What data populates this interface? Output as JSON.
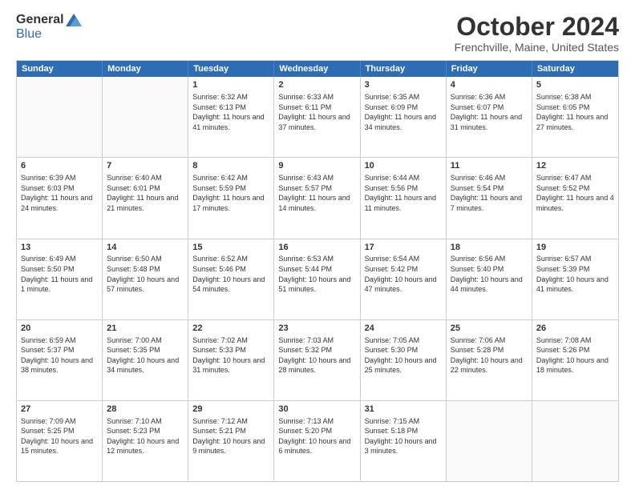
{
  "header": {
    "logo": {
      "general": "General",
      "blue": "Blue"
    },
    "title": "October 2024",
    "location": "Frenchville, Maine, United States"
  },
  "calendar": {
    "days": [
      "Sunday",
      "Monday",
      "Tuesday",
      "Wednesday",
      "Thursday",
      "Friday",
      "Saturday"
    ],
    "rows": [
      [
        {
          "day": "",
          "content": "",
          "empty": true
        },
        {
          "day": "",
          "content": "",
          "empty": true
        },
        {
          "day": "1",
          "content": "Sunrise: 6:32 AM\nSunset: 6:13 PM\nDaylight: 11 hours and 41 minutes.",
          "empty": false
        },
        {
          "day": "2",
          "content": "Sunrise: 6:33 AM\nSunset: 6:11 PM\nDaylight: 11 hours and 37 minutes.",
          "empty": false
        },
        {
          "day": "3",
          "content": "Sunrise: 6:35 AM\nSunset: 6:09 PM\nDaylight: 11 hours and 34 minutes.",
          "empty": false
        },
        {
          "day": "4",
          "content": "Sunrise: 6:36 AM\nSunset: 6:07 PM\nDaylight: 11 hours and 31 minutes.",
          "empty": false
        },
        {
          "day": "5",
          "content": "Sunrise: 6:38 AM\nSunset: 6:05 PM\nDaylight: 11 hours and 27 minutes.",
          "empty": false
        }
      ],
      [
        {
          "day": "6",
          "content": "Sunrise: 6:39 AM\nSunset: 6:03 PM\nDaylight: 11 hours and 24 minutes.",
          "empty": false
        },
        {
          "day": "7",
          "content": "Sunrise: 6:40 AM\nSunset: 6:01 PM\nDaylight: 11 hours and 21 minutes.",
          "empty": false
        },
        {
          "day": "8",
          "content": "Sunrise: 6:42 AM\nSunset: 5:59 PM\nDaylight: 11 hours and 17 minutes.",
          "empty": false
        },
        {
          "day": "9",
          "content": "Sunrise: 6:43 AM\nSunset: 5:57 PM\nDaylight: 11 hours and 14 minutes.",
          "empty": false
        },
        {
          "day": "10",
          "content": "Sunrise: 6:44 AM\nSunset: 5:56 PM\nDaylight: 11 hours and 11 minutes.",
          "empty": false
        },
        {
          "day": "11",
          "content": "Sunrise: 6:46 AM\nSunset: 5:54 PM\nDaylight: 11 hours and 7 minutes.",
          "empty": false
        },
        {
          "day": "12",
          "content": "Sunrise: 6:47 AM\nSunset: 5:52 PM\nDaylight: 11 hours and 4 minutes.",
          "empty": false
        }
      ],
      [
        {
          "day": "13",
          "content": "Sunrise: 6:49 AM\nSunset: 5:50 PM\nDaylight: 11 hours and 1 minute.",
          "empty": false
        },
        {
          "day": "14",
          "content": "Sunrise: 6:50 AM\nSunset: 5:48 PM\nDaylight: 10 hours and 57 minutes.",
          "empty": false
        },
        {
          "day": "15",
          "content": "Sunrise: 6:52 AM\nSunset: 5:46 PM\nDaylight: 10 hours and 54 minutes.",
          "empty": false
        },
        {
          "day": "16",
          "content": "Sunrise: 6:53 AM\nSunset: 5:44 PM\nDaylight: 10 hours and 51 minutes.",
          "empty": false
        },
        {
          "day": "17",
          "content": "Sunrise: 6:54 AM\nSunset: 5:42 PM\nDaylight: 10 hours and 47 minutes.",
          "empty": false
        },
        {
          "day": "18",
          "content": "Sunrise: 6:56 AM\nSunset: 5:40 PM\nDaylight: 10 hours and 44 minutes.",
          "empty": false
        },
        {
          "day": "19",
          "content": "Sunrise: 6:57 AM\nSunset: 5:39 PM\nDaylight: 10 hours and 41 minutes.",
          "empty": false
        }
      ],
      [
        {
          "day": "20",
          "content": "Sunrise: 6:59 AM\nSunset: 5:37 PM\nDaylight: 10 hours and 38 minutes.",
          "empty": false
        },
        {
          "day": "21",
          "content": "Sunrise: 7:00 AM\nSunset: 5:35 PM\nDaylight: 10 hours and 34 minutes.",
          "empty": false
        },
        {
          "day": "22",
          "content": "Sunrise: 7:02 AM\nSunset: 5:33 PM\nDaylight: 10 hours and 31 minutes.",
          "empty": false
        },
        {
          "day": "23",
          "content": "Sunrise: 7:03 AM\nSunset: 5:32 PM\nDaylight: 10 hours and 28 minutes.",
          "empty": false
        },
        {
          "day": "24",
          "content": "Sunrise: 7:05 AM\nSunset: 5:30 PM\nDaylight: 10 hours and 25 minutes.",
          "empty": false
        },
        {
          "day": "25",
          "content": "Sunrise: 7:06 AM\nSunset: 5:28 PM\nDaylight: 10 hours and 22 minutes.",
          "empty": false
        },
        {
          "day": "26",
          "content": "Sunrise: 7:08 AM\nSunset: 5:26 PM\nDaylight: 10 hours and 18 minutes.",
          "empty": false
        }
      ],
      [
        {
          "day": "27",
          "content": "Sunrise: 7:09 AM\nSunset: 5:25 PM\nDaylight: 10 hours and 15 minutes.",
          "empty": false
        },
        {
          "day": "28",
          "content": "Sunrise: 7:10 AM\nSunset: 5:23 PM\nDaylight: 10 hours and 12 minutes.",
          "empty": false
        },
        {
          "day": "29",
          "content": "Sunrise: 7:12 AM\nSunset: 5:21 PM\nDaylight: 10 hours and 9 minutes.",
          "empty": false
        },
        {
          "day": "30",
          "content": "Sunrise: 7:13 AM\nSunset: 5:20 PM\nDaylight: 10 hours and 6 minutes.",
          "empty": false
        },
        {
          "day": "31",
          "content": "Sunrise: 7:15 AM\nSunset: 5:18 PM\nDaylight: 10 hours and 3 minutes.",
          "empty": false
        },
        {
          "day": "",
          "content": "",
          "empty": true
        },
        {
          "day": "",
          "content": "",
          "empty": true
        }
      ]
    ]
  }
}
